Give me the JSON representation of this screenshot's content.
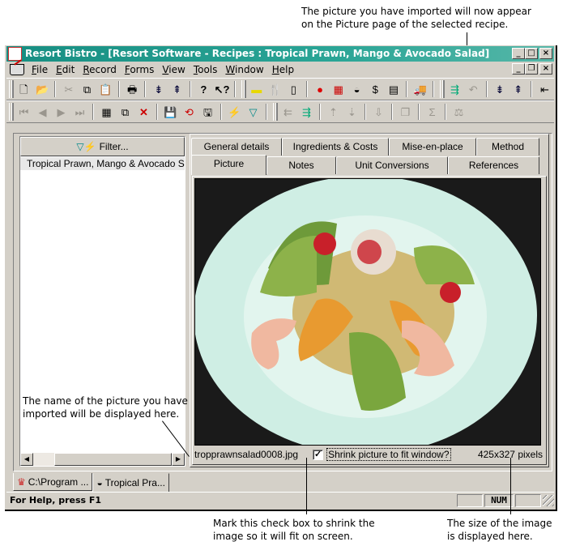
{
  "callouts": {
    "top": [
      "The picture you have imported will now appear",
      "on the Picture page of the selected recipe."
    ],
    "left": [
      "The name of the picture you have",
      "imported will be displayed here."
    ],
    "bottom_checkbox": [
      "Mark this check box to shrink the",
      "image so it will fit on screen."
    ],
    "bottom_size": [
      "The size of the image",
      "is displayed here."
    ]
  },
  "window": {
    "title": "Resort Bistro - [Resort Software - Recipes : Tropical Prawn, Mango & Avocado Salad]",
    "caption_buttons": [
      "_",
      "□",
      "×"
    ],
    "mdi_buttons": [
      "_",
      "❐",
      "×"
    ]
  },
  "menu": {
    "items": [
      {
        "key": "F",
        "rest": "ile"
      },
      {
        "key": "E",
        "rest": "dit"
      },
      {
        "key": "R",
        "rest": "ecord"
      },
      {
        "key": "F",
        "rest": "orms"
      },
      {
        "key": "V",
        "rest": "iew"
      },
      {
        "key": "T",
        "rest": "ools"
      },
      {
        "key": "W",
        "rest": "indow"
      },
      {
        "key": "H",
        "rest": "elp"
      }
    ]
  },
  "toolbar1": {
    "icons": [
      "new-doc",
      "open-folder",
      "|",
      "cut",
      "copy",
      "paste",
      "|",
      "print",
      "|",
      "move-down",
      "move-up",
      "|",
      "help",
      "context-help",
      "||",
      "cheese",
      "utensils",
      "measuring-jug",
      "|",
      "tomato",
      "recipe-card",
      "pot",
      "costing-sheet",
      "book",
      "|",
      "truck",
      "||",
      "import",
      "undo",
      "|",
      "move-down-2",
      "move-up-2",
      "|",
      "back-arrow"
    ]
  },
  "toolbar2": {
    "icons": [
      "first-record",
      "prev-record",
      "next-record",
      "last-record",
      "|",
      "new-record",
      "new-copy",
      "delete",
      "|",
      "save",
      "revert",
      "save-as",
      "|",
      "filter-quick",
      "filter",
      "||",
      "export",
      "import-2",
      "|",
      "move-up-3",
      "move-down-3",
      "|",
      "download",
      "|",
      "windows",
      "|",
      "sum",
      "|",
      "scales"
    ]
  },
  "left_panel": {
    "filter_label": "Filter...",
    "recipes": [
      "Tropical Prawn, Mango & Avocado Salad"
    ]
  },
  "tabs": {
    "row1": [
      "General details",
      "Ingredients & Costs",
      "Mise-en-place",
      "Method"
    ],
    "row2": [
      "Picture",
      "Notes",
      "Unit Conversions",
      "References"
    ],
    "active": "Picture"
  },
  "picture": {
    "filename": "tropprawnsalad0008.jpg",
    "shrink_label": "Shrink picture to fit window?",
    "shrink_checked": true,
    "check_glyph": "✓",
    "size_text": "425x327 pixels",
    "alt": "Tropical prawn, mango and avocado salad on a white plate"
  },
  "doc_tabs": [
    "C:\\Program ...",
    "Tropical Pra..."
  ],
  "status": {
    "text": "For Help, press F1",
    "num": "NUM"
  }
}
